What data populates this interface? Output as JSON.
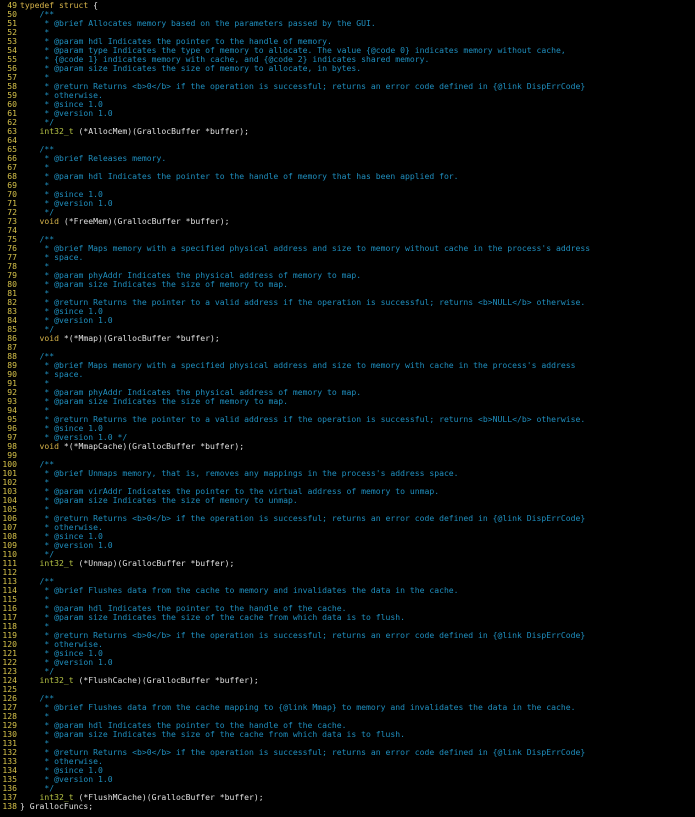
{
  "editor": {
    "lines": [
      {
        "n": "49",
        "segments": [
          {
            "c": "kw",
            "t": "typedef struct "
          },
          {
            "c": "plain",
            "t": "{"
          }
        ]
      },
      {
        "n": "50",
        "segments": [
          {
            "c": "comment",
            "t": "    /**"
          }
        ]
      },
      {
        "n": "51",
        "segments": [
          {
            "c": "comment",
            "t": "     * @brief Allocates memory based on the parameters passed by the GUI."
          }
        ]
      },
      {
        "n": "52",
        "segments": [
          {
            "c": "comment",
            "t": "     *"
          }
        ]
      },
      {
        "n": "53",
        "segments": [
          {
            "c": "comment",
            "t": "     * @param hdl Indicates the pointer to the handle of memory."
          }
        ]
      },
      {
        "n": "54",
        "segments": [
          {
            "c": "comment",
            "t": "     * @param type Indicates the type of memory to allocate. The value {@code 0} indicates memory without cache,"
          }
        ]
      },
      {
        "n": "55",
        "segments": [
          {
            "c": "comment",
            "t": "     * {@code 1} indicates memory with cache, and {@code 2} indicates shared memory."
          }
        ]
      },
      {
        "n": "56",
        "segments": [
          {
            "c": "comment",
            "t": "     * @param size Indicates the size of memory to allocate, in bytes."
          }
        ]
      },
      {
        "n": "57",
        "segments": [
          {
            "c": "comment",
            "t": "     *"
          }
        ]
      },
      {
        "n": "58",
        "segments": [
          {
            "c": "comment",
            "t": "     * @return Returns <b>0</b> if the operation is successful; returns an error code defined in {@link DispErrCode}"
          }
        ]
      },
      {
        "n": "59",
        "segments": [
          {
            "c": "comment",
            "t": "     * otherwise."
          }
        ]
      },
      {
        "n": "60",
        "segments": [
          {
            "c": "comment",
            "t": "     * @since 1.0"
          }
        ]
      },
      {
        "n": "61",
        "segments": [
          {
            "c": "comment",
            "t": "     * @version 1.0"
          }
        ]
      },
      {
        "n": "62",
        "segments": [
          {
            "c": "comment",
            "t": "     */"
          }
        ]
      },
      {
        "n": "63",
        "segments": [
          {
            "c": "type",
            "t": "    int32_t"
          },
          {
            "c": "plain",
            "t": " (*AllocMem)(GrallocBuffer *buffer);"
          }
        ]
      },
      {
        "n": "64",
        "segments": []
      },
      {
        "n": "65",
        "segments": [
          {
            "c": "comment",
            "t": "    /**"
          }
        ]
      },
      {
        "n": "66",
        "segments": [
          {
            "c": "comment",
            "t": "     * @brief Releases memory."
          }
        ]
      },
      {
        "n": "67",
        "segments": [
          {
            "c": "comment",
            "t": "     *"
          }
        ]
      },
      {
        "n": "68",
        "segments": [
          {
            "c": "comment",
            "t": "     * @param hdl Indicates the pointer to the handle of memory that has been applied for."
          }
        ]
      },
      {
        "n": "69",
        "segments": [
          {
            "c": "comment",
            "t": "     *"
          }
        ]
      },
      {
        "n": "70",
        "segments": [
          {
            "c": "comment",
            "t": "     * @since 1.0"
          }
        ]
      },
      {
        "n": "71",
        "segments": [
          {
            "c": "comment",
            "t": "     * @version 1.0"
          }
        ]
      },
      {
        "n": "72",
        "segments": [
          {
            "c": "comment",
            "t": "     */"
          }
        ]
      },
      {
        "n": "73",
        "segments": [
          {
            "c": "kw",
            "t": "    void"
          },
          {
            "c": "plain",
            "t": " (*FreeMem)(GrallocBuffer *buffer);"
          }
        ]
      },
      {
        "n": "74",
        "segments": []
      },
      {
        "n": "75",
        "segments": [
          {
            "c": "comment",
            "t": "    /**"
          }
        ]
      },
      {
        "n": "76",
        "segments": [
          {
            "c": "comment",
            "t": "     * @brief Maps memory with a specified physical address and size to memory without cache in the process's address"
          }
        ]
      },
      {
        "n": "77",
        "segments": [
          {
            "c": "comment",
            "t": "     * space."
          }
        ]
      },
      {
        "n": "78",
        "segments": [
          {
            "c": "comment",
            "t": "     *"
          }
        ]
      },
      {
        "n": "79",
        "segments": [
          {
            "c": "comment",
            "t": "     * @param phyAddr Indicates the physical address of memory to map."
          }
        ]
      },
      {
        "n": "80",
        "segments": [
          {
            "c": "comment",
            "t": "     * @param size Indicates the size of memory to map."
          }
        ]
      },
      {
        "n": "81",
        "segments": [
          {
            "c": "comment",
            "t": "     *"
          }
        ]
      },
      {
        "n": "82",
        "segments": [
          {
            "c": "comment",
            "t": "     * @return Returns the pointer to a valid address if the operation is successful; returns <b>NULL</b> otherwise."
          }
        ]
      },
      {
        "n": "83",
        "segments": [
          {
            "c": "comment",
            "t": "     * @since 1.0"
          }
        ]
      },
      {
        "n": "84",
        "segments": [
          {
            "c": "comment",
            "t": "     * @version 1.0"
          }
        ]
      },
      {
        "n": "85",
        "segments": [
          {
            "c": "comment",
            "t": "     */"
          }
        ]
      },
      {
        "n": "86",
        "segments": [
          {
            "c": "kw",
            "t": "    void"
          },
          {
            "c": "plain",
            "t": " *(*Mmap)(GrallocBuffer *buffer);"
          }
        ]
      },
      {
        "n": "87",
        "segments": []
      },
      {
        "n": "88",
        "segments": [
          {
            "c": "comment",
            "t": "    /**"
          }
        ]
      },
      {
        "n": "89",
        "segments": [
          {
            "c": "comment",
            "t": "     * @brief Maps memory with a specified physical address and size to memory with cache in the process's address"
          }
        ]
      },
      {
        "n": "90",
        "segments": [
          {
            "c": "comment",
            "t": "     * space."
          }
        ]
      },
      {
        "n": "91",
        "segments": [
          {
            "c": "comment",
            "t": "     *"
          }
        ]
      },
      {
        "n": "92",
        "segments": [
          {
            "c": "comment",
            "t": "     * @param phyAddr Indicates the physical address of memory to map."
          }
        ]
      },
      {
        "n": "93",
        "segments": [
          {
            "c": "comment",
            "t": "     * @param size Indicates the size of memory to map."
          }
        ]
      },
      {
        "n": "94",
        "segments": [
          {
            "c": "comment",
            "t": "     *"
          }
        ]
      },
      {
        "n": "95",
        "segments": [
          {
            "c": "comment",
            "t": "     * @return Returns the pointer to a valid address if the operation is successful; returns <b>NULL</b> otherwise."
          }
        ]
      },
      {
        "n": "96",
        "segments": [
          {
            "c": "comment",
            "t": "     * @since 1.0"
          }
        ]
      },
      {
        "n": "97",
        "segments": [
          {
            "c": "comment",
            "t": "     * @version 1.0 */"
          }
        ]
      },
      {
        "n": "98",
        "segments": [
          {
            "c": "kw",
            "t": "    void"
          },
          {
            "c": "plain",
            "t": " *(*MmapCache)(GrallocBuffer *buffer);"
          }
        ]
      },
      {
        "n": "99",
        "segments": []
      },
      {
        "n": "100",
        "segments": [
          {
            "c": "comment",
            "t": "    /**"
          }
        ]
      },
      {
        "n": "101",
        "segments": [
          {
            "c": "comment",
            "t": "     * @brief Unmaps memory, that is, removes any mappings in the process's address space."
          }
        ]
      },
      {
        "n": "102",
        "segments": [
          {
            "c": "comment",
            "t": "     *"
          }
        ]
      },
      {
        "n": "103",
        "segments": [
          {
            "c": "comment",
            "t": "     * @param virAddr Indicates the pointer to the virtual address of memory to unmap."
          }
        ]
      },
      {
        "n": "104",
        "segments": [
          {
            "c": "comment",
            "t": "     * @param size Indicates the size of memory to unmap."
          }
        ]
      },
      {
        "n": "105",
        "segments": [
          {
            "c": "comment",
            "t": "     *"
          }
        ]
      },
      {
        "n": "106",
        "segments": [
          {
            "c": "comment",
            "t": "     * @return Returns <b>0</b> if the operation is successful; returns an error code defined in {@link DispErrCode}"
          }
        ]
      },
      {
        "n": "107",
        "segments": [
          {
            "c": "comment",
            "t": "     * otherwise."
          }
        ]
      },
      {
        "n": "108",
        "segments": [
          {
            "c": "comment",
            "t": "     * @since 1.0"
          }
        ]
      },
      {
        "n": "109",
        "segments": [
          {
            "c": "comment",
            "t": "     * @version 1.0"
          }
        ]
      },
      {
        "n": "110",
        "segments": [
          {
            "c": "comment",
            "t": "     */"
          }
        ]
      },
      {
        "n": "111",
        "segments": [
          {
            "c": "type",
            "t": "    int32_t"
          },
          {
            "c": "plain",
            "t": " (*Unmap)(GrallocBuffer *buffer);"
          }
        ]
      },
      {
        "n": "112",
        "segments": []
      },
      {
        "n": "113",
        "segments": [
          {
            "c": "comment",
            "t": "    /**"
          }
        ]
      },
      {
        "n": "114",
        "segments": [
          {
            "c": "comment",
            "t": "     * @brief Flushes data from the cache to memory and invalidates the data in the cache."
          }
        ]
      },
      {
        "n": "115",
        "segments": [
          {
            "c": "comment",
            "t": "     *"
          }
        ]
      },
      {
        "n": "116",
        "segments": [
          {
            "c": "comment",
            "t": "     * @param hdl Indicates the pointer to the handle of the cache."
          }
        ]
      },
      {
        "n": "117",
        "segments": [
          {
            "c": "comment",
            "t": "     * @param size Indicates the size of the cache from which data is to flush."
          }
        ]
      },
      {
        "n": "118",
        "segments": [
          {
            "c": "comment",
            "t": "     *"
          }
        ]
      },
      {
        "n": "119",
        "segments": [
          {
            "c": "comment",
            "t": "     * @return Returns <b>0</b> if the operation is successful; returns an error code defined in {@link DispErrCode}"
          }
        ]
      },
      {
        "n": "120",
        "segments": [
          {
            "c": "comment",
            "t": "     * otherwise."
          }
        ]
      },
      {
        "n": "121",
        "segments": [
          {
            "c": "comment",
            "t": "     * @since 1.0"
          }
        ]
      },
      {
        "n": "122",
        "segments": [
          {
            "c": "comment",
            "t": "     * @version 1.0"
          }
        ]
      },
      {
        "n": "123",
        "segments": [
          {
            "c": "comment",
            "t": "     */"
          }
        ]
      },
      {
        "n": "124",
        "segments": [
          {
            "c": "type",
            "t": "    int32_t"
          },
          {
            "c": "plain",
            "t": " (*FlushCache)(GrallocBuffer *buffer);"
          }
        ]
      },
      {
        "n": "125",
        "segments": []
      },
      {
        "n": "126",
        "segments": [
          {
            "c": "comment",
            "t": "    /**"
          }
        ]
      },
      {
        "n": "127",
        "segments": [
          {
            "c": "comment",
            "t": "     * @brief Flushes data from the cache mapping to {@link Mmap} to memory and invalidates the data in the cache."
          }
        ]
      },
      {
        "n": "128",
        "segments": [
          {
            "c": "comment",
            "t": "     *"
          }
        ]
      },
      {
        "n": "129",
        "segments": [
          {
            "c": "comment",
            "t": "     * @param hdl Indicates the pointer to the handle of the cache."
          }
        ]
      },
      {
        "n": "130",
        "segments": [
          {
            "c": "comment",
            "t": "     * @param size Indicates the size of the cache from which data is to flush."
          }
        ]
      },
      {
        "n": "131",
        "segments": [
          {
            "c": "comment",
            "t": "     *"
          }
        ]
      },
      {
        "n": "132",
        "segments": [
          {
            "c": "comment",
            "t": "     * @return Returns <b>0</b> if the operation is successful; returns an error code defined in {@link DispErrCode}"
          }
        ]
      },
      {
        "n": "133",
        "segments": [
          {
            "c": "comment",
            "t": "     * otherwise."
          }
        ]
      },
      {
        "n": "134",
        "segments": [
          {
            "c": "comment",
            "t": "     * @since 1.0"
          }
        ]
      },
      {
        "n": "135",
        "segments": [
          {
            "c": "comment",
            "t": "     * @version 1.0"
          }
        ]
      },
      {
        "n": "136",
        "segments": [
          {
            "c": "comment",
            "t": "     */"
          }
        ]
      },
      {
        "n": "137",
        "segments": [
          {
            "c": "type",
            "t": "    int32_t"
          },
          {
            "c": "plain",
            "t": " (*FlushMCache)(GrallocBuffer *buffer);"
          }
        ]
      },
      {
        "n": "138",
        "segments": [
          {
            "c": "plain",
            "t": "} GrallocFuncs;"
          }
        ]
      }
    ]
  }
}
